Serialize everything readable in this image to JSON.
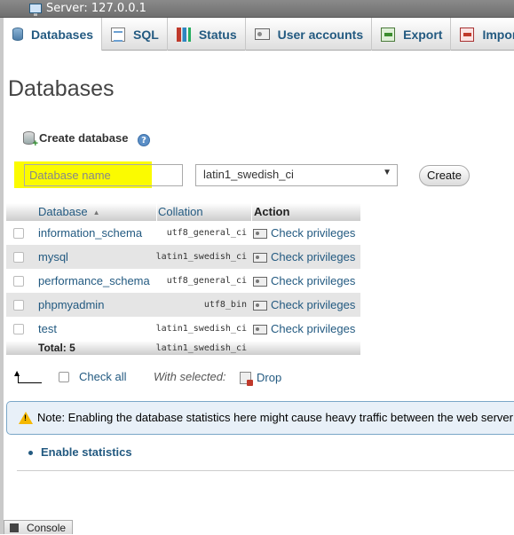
{
  "server": {
    "title": "Server: 127.0.0.1"
  },
  "tabs": [
    {
      "label": "Databases",
      "icon": "database-icon"
    },
    {
      "label": "SQL",
      "icon": "sql-icon"
    },
    {
      "label": "Status",
      "icon": "status-icon"
    },
    {
      "label": "User accounts",
      "icon": "users-icon"
    },
    {
      "label": "Export",
      "icon": "export-icon"
    },
    {
      "label": "Import",
      "icon": "import-icon"
    }
  ],
  "page": {
    "title": "Databases"
  },
  "create": {
    "header": "Create database",
    "help_glyph": "?",
    "name_placeholder": "Database name",
    "collation_value": "latin1_swedish_ci",
    "create_label": "Create",
    "highlight_color": "#fbfb00"
  },
  "table": {
    "headers": {
      "database": "Database",
      "collation": "Collation",
      "action": "Action"
    },
    "rows": [
      {
        "name": "information_schema",
        "collation": "utf8_general_ci",
        "action": "Check privileges"
      },
      {
        "name": "mysql",
        "collation": "latin1_swedish_ci",
        "action": "Check privileges"
      },
      {
        "name": "performance_schema",
        "collation": "utf8_general_ci",
        "action": "Check privileges"
      },
      {
        "name": "phpmyadmin",
        "collation": "utf8_bin",
        "action": "Check privileges"
      },
      {
        "name": "test",
        "collation": "latin1_swedish_ci",
        "action": "Check privileges"
      }
    ],
    "total_label": "Total: 5",
    "total_collation": "latin1_swedish_ci"
  },
  "bulk": {
    "check_all": "Check all",
    "with_selected": "With selected:",
    "drop": "Drop"
  },
  "notice": {
    "text": "Note: Enabling the database statistics here might cause heavy traffic between the web server"
  },
  "stats": {
    "enable_label": "Enable statistics"
  },
  "console": {
    "label": "Console"
  },
  "colors": {
    "link": "#235a81",
    "notice_bg": "#e8f0f8",
    "row_alt": "#e5e5e5"
  }
}
